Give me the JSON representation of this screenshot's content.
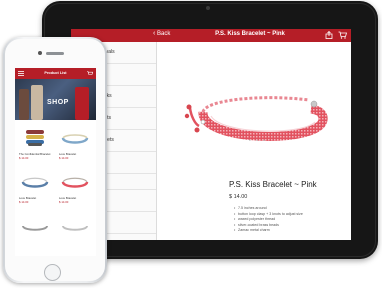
{
  "ipad": {
    "nav": {
      "back_label": "Back",
      "title": "P.S. Kiss Bracelet ~ Pink"
    },
    "sidebar": [
      {
        "label": "Arrivals"
      },
      {
        "label": "es"
      },
      {
        "label": "Packs"
      },
      {
        "label": "celets"
      },
      {
        "label": "acelets"
      },
      {
        "label": ""
      },
      {
        "label": "ries"
      },
      {
        "label": "s"
      },
      {
        "label": "s"
      }
    ],
    "product": {
      "title": "P.S. Kiss Bracelet ~ Pink",
      "price": "$ 14.00",
      "bullets": [
        "7.5 inches around",
        "button loop clasp + 3 knots to adjust size",
        "waxed polyester thread",
        "silver-coated brass beads",
        "Zamac metal charm"
      ],
      "quantity": "1",
      "minus": "−",
      "plus": "+"
    }
  },
  "iphone": {
    "nav": {
      "title": "Product List"
    },
    "banner_text": "SHOP",
    "products": [
      {
        "name": "The Confidential Bracelet",
        "price": "$ 14.00"
      },
      {
        "name": "Love Bracelet",
        "price": "$ 14.00"
      },
      {
        "name": "Love Bracelet",
        "price": "$ 14.00"
      },
      {
        "name": "Love Bracelet",
        "price": "$ 14.00"
      }
    ]
  },
  "colors": {
    "accent": "#b51e27",
    "bracelet": "#e2525f"
  },
  "icons": {
    "share": "share-icon",
    "cart": "cart-icon",
    "menu": "menu-icon",
    "back": "chevron-left-icon"
  }
}
